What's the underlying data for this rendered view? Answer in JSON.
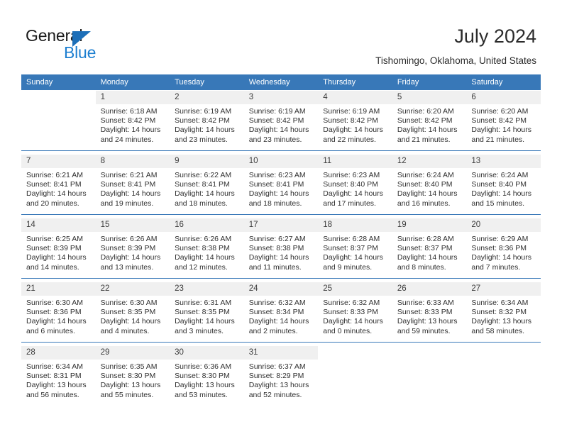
{
  "brand": {
    "name_top": "General",
    "name_bottom": "Blue",
    "triangle_color": "#1d6fb8",
    "blue_color": "#1d7fd0"
  },
  "header": {
    "title": "July 2024",
    "subtitle": "Tishomingo, Oklahoma, United States"
  },
  "theme": {
    "header_bg": "#3878b8",
    "header_text": "#ffffff",
    "daynum_bg": "#f0f0f0",
    "cell_bg": "#ffffff",
    "separator": "#3878b8"
  },
  "calendar": {
    "weekday_headers": [
      "Sunday",
      "Monday",
      "Tuesday",
      "Wednesday",
      "Thursday",
      "Friday",
      "Saturday"
    ],
    "weeks": [
      [
        {
          "day": "",
          "sunrise": "",
          "sunset": "",
          "daylight_line1": "",
          "daylight_line2": ""
        },
        {
          "day": "1",
          "sunrise": "Sunrise: 6:18 AM",
          "sunset": "Sunset: 8:42 PM",
          "daylight_line1": "Daylight: 14 hours",
          "daylight_line2": "and 24 minutes."
        },
        {
          "day": "2",
          "sunrise": "Sunrise: 6:19 AM",
          "sunset": "Sunset: 8:42 PM",
          "daylight_line1": "Daylight: 14 hours",
          "daylight_line2": "and 23 minutes."
        },
        {
          "day": "3",
          "sunrise": "Sunrise: 6:19 AM",
          "sunset": "Sunset: 8:42 PM",
          "daylight_line1": "Daylight: 14 hours",
          "daylight_line2": "and 23 minutes."
        },
        {
          "day": "4",
          "sunrise": "Sunrise: 6:19 AM",
          "sunset": "Sunset: 8:42 PM",
          "daylight_line1": "Daylight: 14 hours",
          "daylight_line2": "and 22 minutes."
        },
        {
          "day": "5",
          "sunrise": "Sunrise: 6:20 AM",
          "sunset": "Sunset: 8:42 PM",
          "daylight_line1": "Daylight: 14 hours",
          "daylight_line2": "and 21 minutes."
        },
        {
          "day": "6",
          "sunrise": "Sunrise: 6:20 AM",
          "sunset": "Sunset: 8:42 PM",
          "daylight_line1": "Daylight: 14 hours",
          "daylight_line2": "and 21 minutes."
        }
      ],
      [
        {
          "day": "7",
          "sunrise": "Sunrise: 6:21 AM",
          "sunset": "Sunset: 8:41 PM",
          "daylight_line1": "Daylight: 14 hours",
          "daylight_line2": "and 20 minutes."
        },
        {
          "day": "8",
          "sunrise": "Sunrise: 6:21 AM",
          "sunset": "Sunset: 8:41 PM",
          "daylight_line1": "Daylight: 14 hours",
          "daylight_line2": "and 19 minutes."
        },
        {
          "day": "9",
          "sunrise": "Sunrise: 6:22 AM",
          "sunset": "Sunset: 8:41 PM",
          "daylight_line1": "Daylight: 14 hours",
          "daylight_line2": "and 18 minutes."
        },
        {
          "day": "10",
          "sunrise": "Sunrise: 6:23 AM",
          "sunset": "Sunset: 8:41 PM",
          "daylight_line1": "Daylight: 14 hours",
          "daylight_line2": "and 18 minutes."
        },
        {
          "day": "11",
          "sunrise": "Sunrise: 6:23 AM",
          "sunset": "Sunset: 8:40 PM",
          "daylight_line1": "Daylight: 14 hours",
          "daylight_line2": "and 17 minutes."
        },
        {
          "day": "12",
          "sunrise": "Sunrise: 6:24 AM",
          "sunset": "Sunset: 8:40 PM",
          "daylight_line1": "Daylight: 14 hours",
          "daylight_line2": "and 16 minutes."
        },
        {
          "day": "13",
          "sunrise": "Sunrise: 6:24 AM",
          "sunset": "Sunset: 8:40 PM",
          "daylight_line1": "Daylight: 14 hours",
          "daylight_line2": "and 15 minutes."
        }
      ],
      [
        {
          "day": "14",
          "sunrise": "Sunrise: 6:25 AM",
          "sunset": "Sunset: 8:39 PM",
          "daylight_line1": "Daylight: 14 hours",
          "daylight_line2": "and 14 minutes."
        },
        {
          "day": "15",
          "sunrise": "Sunrise: 6:26 AM",
          "sunset": "Sunset: 8:39 PM",
          "daylight_line1": "Daylight: 14 hours",
          "daylight_line2": "and 13 minutes."
        },
        {
          "day": "16",
          "sunrise": "Sunrise: 6:26 AM",
          "sunset": "Sunset: 8:38 PM",
          "daylight_line1": "Daylight: 14 hours",
          "daylight_line2": "and 12 minutes."
        },
        {
          "day": "17",
          "sunrise": "Sunrise: 6:27 AM",
          "sunset": "Sunset: 8:38 PM",
          "daylight_line1": "Daylight: 14 hours",
          "daylight_line2": "and 11 minutes."
        },
        {
          "day": "18",
          "sunrise": "Sunrise: 6:28 AM",
          "sunset": "Sunset: 8:37 PM",
          "daylight_line1": "Daylight: 14 hours",
          "daylight_line2": "and 9 minutes."
        },
        {
          "day": "19",
          "sunrise": "Sunrise: 6:28 AM",
          "sunset": "Sunset: 8:37 PM",
          "daylight_line1": "Daylight: 14 hours",
          "daylight_line2": "and 8 minutes."
        },
        {
          "day": "20",
          "sunrise": "Sunrise: 6:29 AM",
          "sunset": "Sunset: 8:36 PM",
          "daylight_line1": "Daylight: 14 hours",
          "daylight_line2": "and 7 minutes."
        }
      ],
      [
        {
          "day": "21",
          "sunrise": "Sunrise: 6:30 AM",
          "sunset": "Sunset: 8:36 PM",
          "daylight_line1": "Daylight: 14 hours",
          "daylight_line2": "and 6 minutes."
        },
        {
          "day": "22",
          "sunrise": "Sunrise: 6:30 AM",
          "sunset": "Sunset: 8:35 PM",
          "daylight_line1": "Daylight: 14 hours",
          "daylight_line2": "and 4 minutes."
        },
        {
          "day": "23",
          "sunrise": "Sunrise: 6:31 AM",
          "sunset": "Sunset: 8:35 PM",
          "daylight_line1": "Daylight: 14 hours",
          "daylight_line2": "and 3 minutes."
        },
        {
          "day": "24",
          "sunrise": "Sunrise: 6:32 AM",
          "sunset": "Sunset: 8:34 PM",
          "daylight_line1": "Daylight: 14 hours",
          "daylight_line2": "and 2 minutes."
        },
        {
          "day": "25",
          "sunrise": "Sunrise: 6:32 AM",
          "sunset": "Sunset: 8:33 PM",
          "daylight_line1": "Daylight: 14 hours",
          "daylight_line2": "and 0 minutes."
        },
        {
          "day": "26",
          "sunrise": "Sunrise: 6:33 AM",
          "sunset": "Sunset: 8:33 PM",
          "daylight_line1": "Daylight: 13 hours",
          "daylight_line2": "and 59 minutes."
        },
        {
          "day": "27",
          "sunrise": "Sunrise: 6:34 AM",
          "sunset": "Sunset: 8:32 PM",
          "daylight_line1": "Daylight: 13 hours",
          "daylight_line2": "and 58 minutes."
        }
      ],
      [
        {
          "day": "28",
          "sunrise": "Sunrise: 6:34 AM",
          "sunset": "Sunset: 8:31 PM",
          "daylight_line1": "Daylight: 13 hours",
          "daylight_line2": "and 56 minutes."
        },
        {
          "day": "29",
          "sunrise": "Sunrise: 6:35 AM",
          "sunset": "Sunset: 8:30 PM",
          "daylight_line1": "Daylight: 13 hours",
          "daylight_line2": "and 55 minutes."
        },
        {
          "day": "30",
          "sunrise": "Sunrise: 6:36 AM",
          "sunset": "Sunset: 8:30 PM",
          "daylight_line1": "Daylight: 13 hours",
          "daylight_line2": "and 53 minutes."
        },
        {
          "day": "31",
          "sunrise": "Sunrise: 6:37 AM",
          "sunset": "Sunset: 8:29 PM",
          "daylight_line1": "Daylight: 13 hours",
          "daylight_line2": "and 52 minutes."
        },
        {
          "day": "",
          "sunrise": "",
          "sunset": "",
          "daylight_line1": "",
          "daylight_line2": ""
        },
        {
          "day": "",
          "sunrise": "",
          "sunset": "",
          "daylight_line1": "",
          "daylight_line2": ""
        },
        {
          "day": "",
          "sunrise": "",
          "sunset": "",
          "daylight_line1": "",
          "daylight_line2": ""
        }
      ]
    ]
  }
}
